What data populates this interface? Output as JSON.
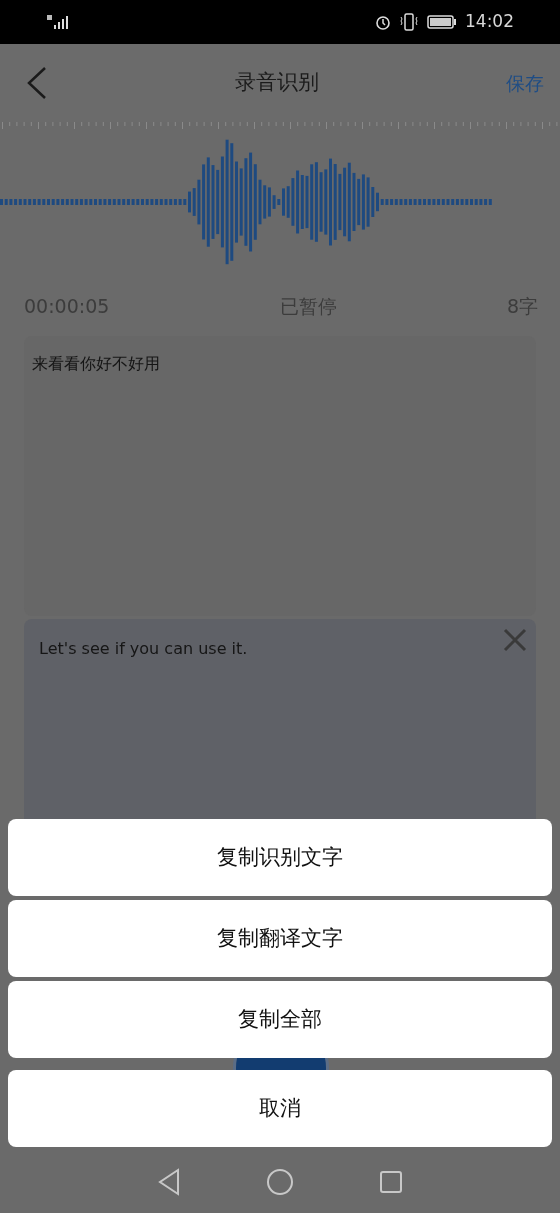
{
  "status_bar": {
    "time": "14:02"
  },
  "header": {
    "title": "录音识别",
    "save": "保存"
  },
  "info": {
    "elapsed": "00:00:05",
    "state": "已暂停",
    "count": "8字"
  },
  "recognized_text": "来看看你好不好用",
  "translation": {
    "text": "Let's see if you can use it."
  },
  "action_sheet": {
    "actions": [
      "复制识别文字",
      "复制翻译文字",
      "复制全部"
    ],
    "cancel": "取消"
  }
}
